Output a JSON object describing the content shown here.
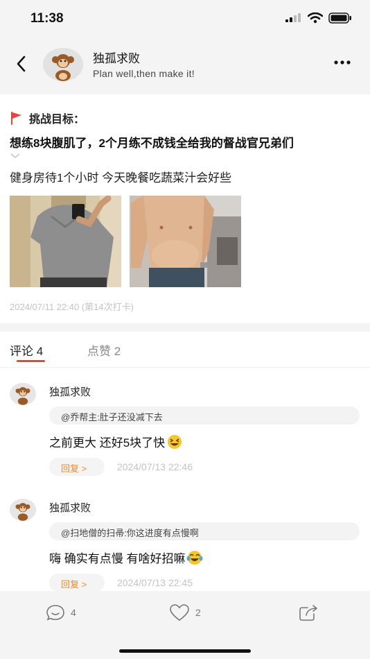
{
  "status": {
    "time": "11:38"
  },
  "header": {
    "username": "独孤求败",
    "motto": "Plan well,then make it!"
  },
  "post": {
    "goal_label": "挑战目标：",
    "goal_text": "想练8块腹肌了，2个月练不成钱全给我的督战官兄弟们",
    "text": "健身房待1个小时 今天晚餐吃蔬菜汁会好些",
    "date_line": "2024/07/11 22:40 (第14次打卡)"
  },
  "tabs": {
    "comments": "评论 4",
    "likes": "点赞 2"
  },
  "comments": [
    {
      "name": "独孤求败",
      "reply_to": "@乔帮主:肚子还没减下去",
      "text": "之前更大 还好5块了快",
      "reply_label": "回复 >",
      "date": "2024/07/13 22:46"
    },
    {
      "name": "独孤求败",
      "reply_to": "@扫地僧的扫帚:你这进度有点慢啊",
      "text": "嗨 确实有点慢 有啥好招嘛",
      "reply_label": "回复 >",
      "date": "2024/07/13 22:45"
    }
  ],
  "bottom": {
    "comment_count": "4",
    "like_count": "2"
  },
  "colors": {
    "accent": "#e8463a",
    "reply": "#f08a2a"
  }
}
